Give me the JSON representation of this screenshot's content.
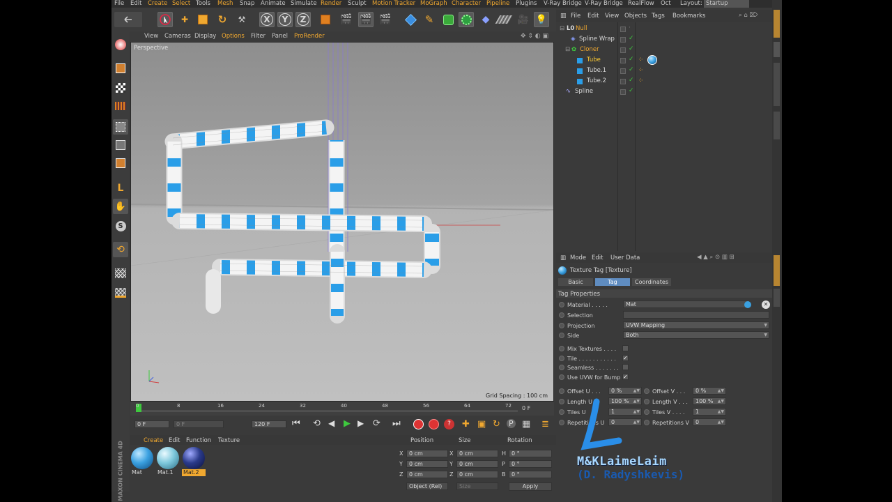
{
  "menu": {
    "items": [
      "File",
      "Edit",
      "Create",
      "Select",
      "Tools",
      "Mesh",
      "Snap",
      "Animate",
      "Simulate",
      "Render",
      "Sculpt",
      "Motion Tracker",
      "MoGraph",
      "Character",
      "Pipeline",
      "Plugins",
      "V-Ray Bridge",
      "V-Ray Bridge",
      "RealFlow",
      "Oct"
    ],
    "layout_label": "Layout:",
    "layout_value": "Startup"
  },
  "viewport": {
    "menu": [
      "View",
      "Cameras",
      "Display",
      "Options",
      "Filter",
      "Panel",
      "ProRender"
    ],
    "label": "Perspective",
    "grid_spacing": "Grid Spacing : 100 cm"
  },
  "timeline": {
    "ticks": [
      "0",
      "8",
      "16",
      "24",
      "32",
      "40",
      "48",
      "56",
      "64",
      "72"
    ],
    "frame_display": "0 F",
    "start_frame": "0 F",
    "range_display": "0 F",
    "end_frame": "120 F"
  },
  "objects": {
    "menu": [
      "File",
      "Edit",
      "View",
      "Objects",
      "Tags",
      "Bookmarks"
    ],
    "items": [
      {
        "name": "Null"
      },
      {
        "name": "Spline Wrap"
      },
      {
        "name": "Cloner"
      },
      {
        "name": "Tube"
      },
      {
        "name": "Tube.1"
      },
      {
        "name": "Tube.2"
      },
      {
        "name": "Spline"
      }
    ]
  },
  "attributes": {
    "menu": [
      "Mode",
      "Edit",
      "User Data"
    ],
    "title": "Texture Tag [Texture]",
    "tabs": [
      "Basic",
      "Tag",
      "Coordinates"
    ],
    "active_tab": "Tag",
    "section": "Tag Properties",
    "material_label": "Material . . . . .",
    "material_value": "Mat",
    "selection_label": "Selection",
    "projection_label": "Projection",
    "projection_value": "UVW Mapping",
    "side_label": "Side",
    "side_value": "Both",
    "mix_textures_label": "Mix Textures . . . .",
    "tile_label": "Tile . . . . . . . . . . .",
    "seamless_label": "Seamless . . . . . . .",
    "use_uvw_label": "Use UVW for Bump",
    "offset_u_label": "Offset U . . .",
    "offset_u_value": "0 %",
    "offset_v_label": "Offset V . . .",
    "offset_v_value": "0 %",
    "length_u_label": "Length U",
    "length_u_value": "100 %",
    "length_v_label": "Length V . . .",
    "length_v_value": "100 %",
    "tiles_u_label": "Tiles U",
    "tiles_u_value": "1",
    "tiles_v_label": "Tiles V . . . .",
    "tiles_v_value": "1",
    "repetitions_u_label": "Repetitions U",
    "repetitions_u_value": "0",
    "repetitions_v_label": "Repetitions V",
    "repetitions_v_value": "0"
  },
  "materials": {
    "menu": [
      "Create",
      "Edit",
      "Function",
      "Texture"
    ],
    "items": [
      {
        "name": "Mat",
        "color": "#3aa0e0"
      },
      {
        "name": "Mat.1",
        "color": "#7ec8dc"
      },
      {
        "name": "Mat.2",
        "color": "#2a3a8a"
      }
    ]
  },
  "coordinates": {
    "headers": [
      "Position",
      "Size",
      "Rotation"
    ],
    "rows": [
      {
        "axis": "X",
        "pos": "0 cm",
        "size_axis": "X",
        "size": "0 cm",
        "rot_axis": "H",
        "rot": "0 °"
      },
      {
        "axis": "Y",
        "pos": "0 cm",
        "size_axis": "Y",
        "size": "0 cm",
        "rot_axis": "P",
        "rot": "0 °"
      },
      {
        "axis": "Z",
        "pos": "0 cm",
        "size_axis": "Z",
        "size": "0 cm",
        "rot_axis": "B",
        "rot": "0 °"
      }
    ],
    "mode": "Object (Rel)",
    "size_mode": "Size",
    "apply_label": "Apply"
  },
  "brand": {
    "vertical": "MAXON CINEMA 4D",
    "watermark_line1": "M&KLaimeLaim",
    "watermark_line2": "(D. Radyshkevis)"
  },
  "colors": {
    "accent": "#f0a830",
    "tube_blue": "#2a9ee8",
    "selected_object": "#ffcc33"
  }
}
